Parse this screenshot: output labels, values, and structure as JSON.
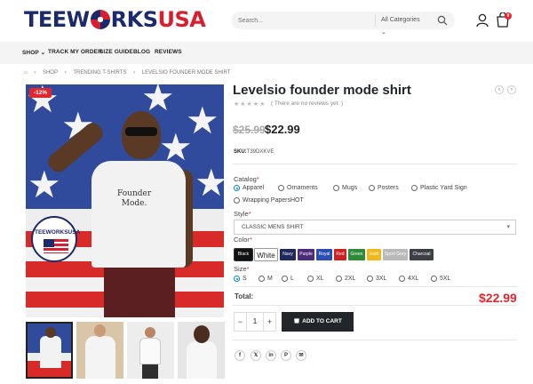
{
  "brand": {
    "part1": "TEEW",
    "part2": "RKS",
    "part3": "USA"
  },
  "search": {
    "placeholder": "Search...",
    "category": "All Categories",
    "chevron": "⌄"
  },
  "header": {
    "cart_count": "0"
  },
  "nav": [
    {
      "label": "SHOP ⌄"
    },
    {
      "label": "TRACK MY ORDER"
    },
    {
      "label": "SIZE GUIDE"
    },
    {
      "label": "BLOG"
    },
    {
      "label": "REVIEWS"
    }
  ],
  "breadcrumb": [
    "⌂",
    "›",
    "SHOP",
    "›",
    "TRENDING T-SHIRTS",
    "›",
    "LEVELSIO FOUNDER MODE SHIRT"
  ],
  "gallery": {
    "sale_badge": "-12%",
    "shirt_line1": "Founder",
    "shirt_line2": "Mode.",
    "badge_logo_text": "TEEWORKSUSA"
  },
  "product": {
    "title": "Levelsio founder mode shirt",
    "rating_stars": "★★★★★",
    "rating": 0,
    "reviews_text": "( There are no reviews yet. )",
    "old_price": "$25.99",
    "price": "$22.99",
    "sku_label": "SKU:",
    "sku": "T39DXKVE",
    "nav_prev": "‹",
    "nav_next": "›"
  },
  "catalog": {
    "label": "Catalog",
    "req": "*",
    "options": [
      {
        "label": "Apparel",
        "selected": true
      },
      {
        "label": "Ornaments",
        "selected": false
      },
      {
        "label": "Mugs",
        "selected": false
      },
      {
        "label": "Posters",
        "selected": false
      },
      {
        "label": "Plastic Yard Sign",
        "selected": false
      },
      {
        "label": "Wrapping PapersHOT",
        "selected": false
      }
    ]
  },
  "style": {
    "label": "Style",
    "req": "*",
    "value": "CLASSIC MENS SHIRT",
    "arrow": "▾"
  },
  "color": {
    "label": "Color",
    "req": "*",
    "swatches": [
      {
        "label": "Black",
        "hex": "#111111",
        "text": "#ffffff"
      },
      {
        "label": "White",
        "hex": "#ffffff",
        "text": "#222222"
      },
      {
        "label": "Navy",
        "hex": "#1f2a5c",
        "text": "#ffffff"
      },
      {
        "label": "Purple",
        "hex": "#4a2c7a",
        "text": "#ffffff"
      },
      {
        "label": "Royal",
        "hex": "#2b4eb5",
        "text": "#ffffff"
      },
      {
        "label": "Red",
        "hex": "#cc2222",
        "text": "#ffffff"
      },
      {
        "label": "Green",
        "hex": "#2e8b3a",
        "text": "#ffffff"
      },
      {
        "label": "Gold",
        "hex": "#f0b819",
        "text": "#ffffff"
      },
      {
        "label": "Sport Grey",
        "hex": "#b9b9b9",
        "text": "#ffffff"
      },
      {
        "label": "Charcoal",
        "hex": "#3c3f45",
        "text": "#ffffff"
      }
    ]
  },
  "size": {
    "label": "Size",
    "req": "*",
    "options": [
      {
        "label": "S",
        "selected": true
      },
      {
        "label": "M",
        "selected": false
      },
      {
        "label": "L",
        "selected": false
      },
      {
        "label": "XL",
        "selected": false
      },
      {
        "label": "2XL",
        "selected": false
      },
      {
        "label": "3XL",
        "selected": false
      },
      {
        "label": "4XL",
        "selected": false
      },
      {
        "label": "5XL",
        "selected": false
      }
    ]
  },
  "total": {
    "label": "Total:",
    "value": "$22.99"
  },
  "qty": {
    "minus": "−",
    "value": "1",
    "plus": "+"
  },
  "add_to_cart": "ADD TO CART",
  "share": [
    {
      "icon": "facebook-icon",
      "glyph": "f"
    },
    {
      "icon": "x-icon",
      "glyph": "𝕏"
    },
    {
      "icon": "linkedin-icon",
      "glyph": "in"
    },
    {
      "icon": "pinterest-icon",
      "glyph": "P"
    },
    {
      "icon": "email-icon",
      "glyph": "✉"
    }
  ],
  "colors": {
    "accent": "#e0272f",
    "brand_navy": "#1c2a6b",
    "dark_button": "#222529",
    "link": "#0088cc"
  }
}
